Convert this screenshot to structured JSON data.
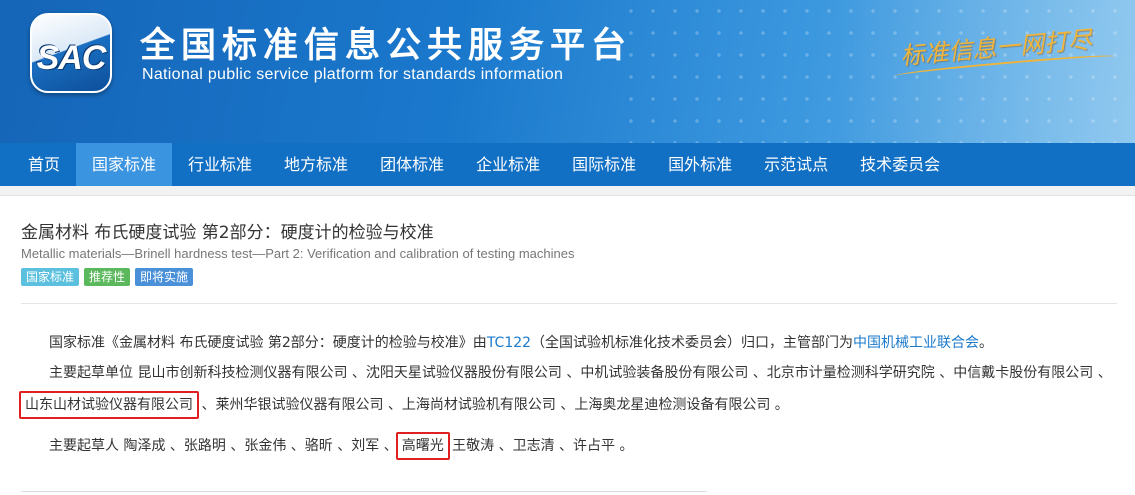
{
  "header": {
    "logo_text": "SAC",
    "title_cn": "全国标准信息公共服务平台",
    "title_en": "National public service platform  for standards information",
    "slogan": "标准信息一网打尽"
  },
  "nav": {
    "items": [
      "首页",
      "国家标准",
      "行业标准",
      "地方标准",
      "团体标准",
      "企业标准",
      "国际标准",
      "国外标准",
      "示范试点",
      "技术委员会"
    ],
    "active_index": 1
  },
  "standard": {
    "title_cn": "金属材料 布氏硬度试验 第2部分：硬度计的检验与校准",
    "title_en": "Metallic materials—Brinell hardness test—Part 2: Verification and calibration of testing machines",
    "tags": [
      "国家标准",
      "推荐性",
      "即将实施"
    ],
    "desc_prefix": "国家标准《金属材料 布氏硬度试验 第2部分：硬度计的检验与校准》由",
    "tc_link": "TC122",
    "desc_middle": "（全国试验机标准化技术委员会）归口，主管部门为",
    "authority_link": "中国机械工业联合会",
    "desc_suffix": "。",
    "units_label": "主要起草单位",
    "units_line1": "昆山市创新科技检测仪器有限公司 、沈阳天星试验仪器股份有限公司 、中机试验装备股份有限公司 、北京市计量检测科学研究院 、中信戴卡股份有限公司 、",
    "units_highlight": "山东山材试验仪器有限公司",
    "units_line2_rest": "、莱州华银试验仪器有限公司 、上海尚材试验机有限公司 、上海奥龙星迪检测设备有限公司 。",
    "drafters_label": "主要起草人",
    "drafters_before": "陶泽成 、张路明 、张金伟 、骆昕 、刘军 、",
    "drafters_highlight": "高曙光",
    "drafters_after": "王敬涛 、卫志清 、许占平 。"
  },
  "colors": {
    "nav_bg": "#1270c4",
    "nav_active": "#3a94e0",
    "link": "#1a7acc",
    "highlight_border": "#e02020"
  }
}
